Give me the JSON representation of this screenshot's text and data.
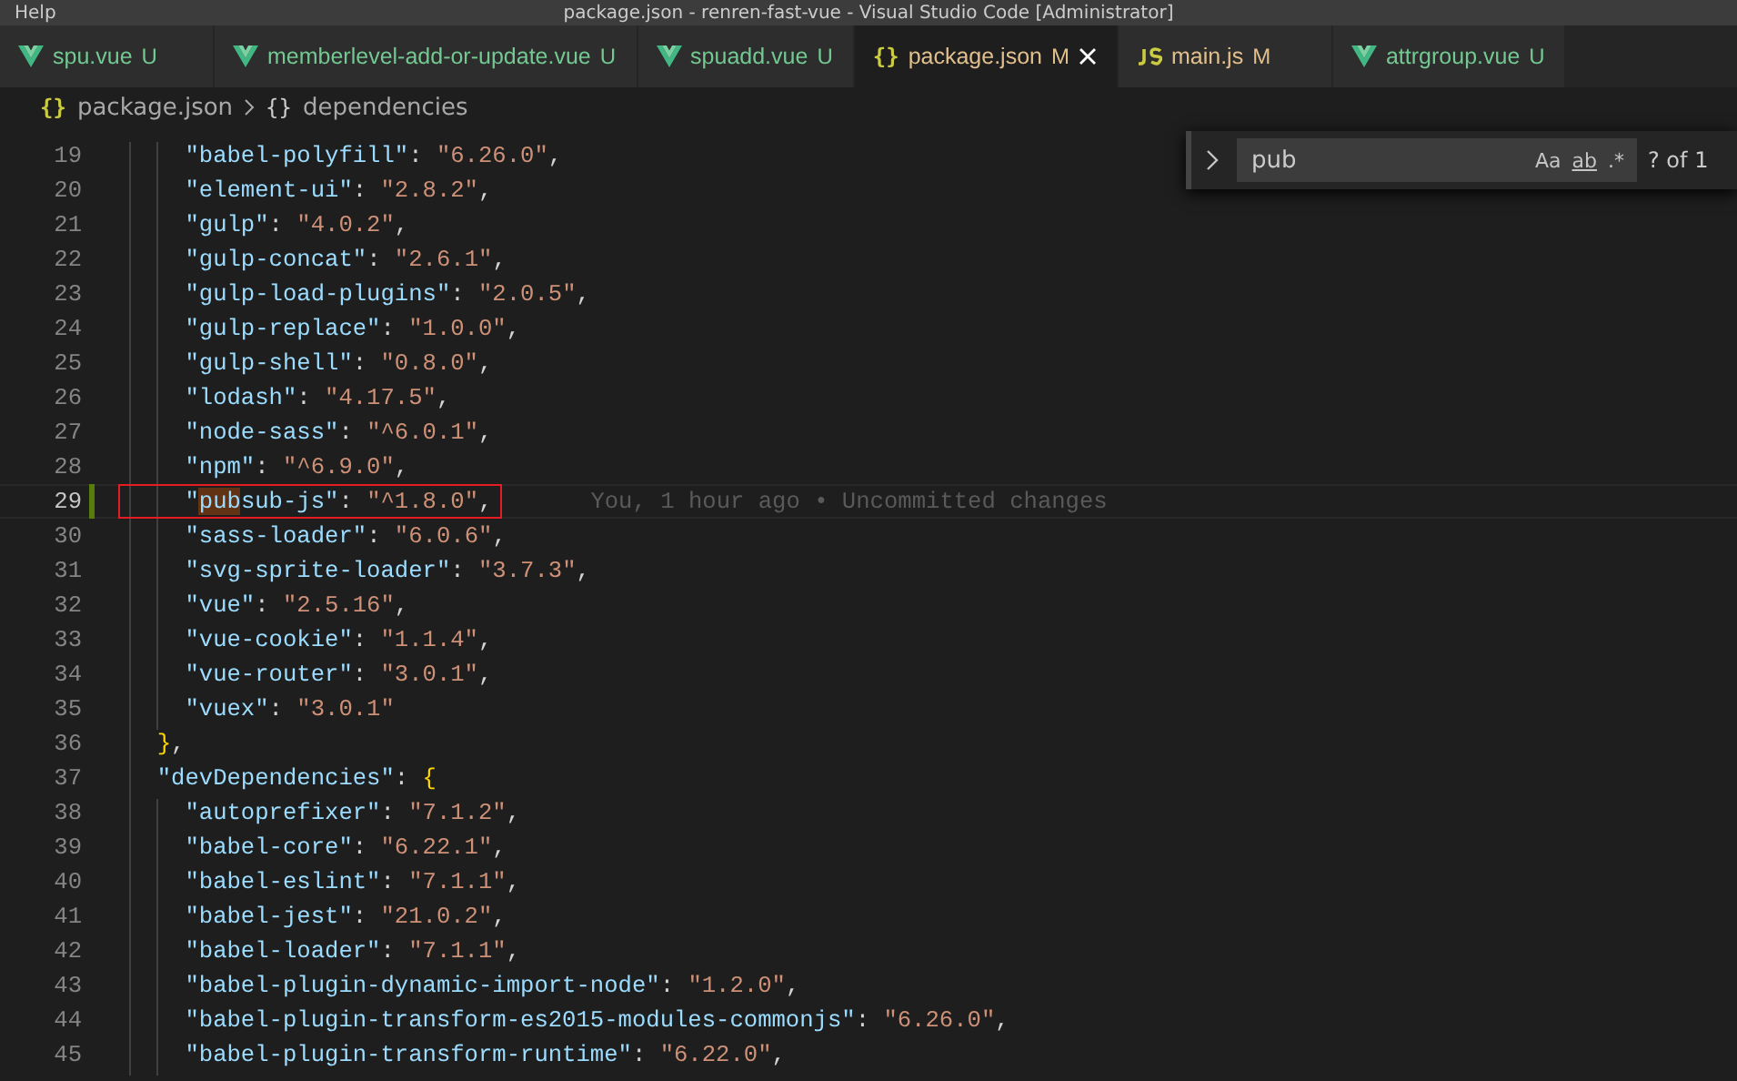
{
  "title_bar": {
    "menu": "Help",
    "title": "package.json - renren-fast-vue - Visual Studio Code [Administrator]"
  },
  "tabs": [
    {
      "kind": "vue",
      "label": "spu.vue",
      "status": "U",
      "selected": false
    },
    {
      "kind": "vue",
      "label": "memberlevel-add-or-update.vue",
      "status": "U",
      "selected": false
    },
    {
      "kind": "vue",
      "label": "spuadd.vue",
      "status": "U",
      "selected": false
    },
    {
      "kind": "json",
      "label": "package.json",
      "status": "M",
      "selected": true
    },
    {
      "kind": "js",
      "label": "main.js",
      "status": "M",
      "selected": false
    },
    {
      "kind": "vue",
      "label": "attrgroup.vue",
      "status": "U",
      "selected": false
    }
  ],
  "breadcrumb": [
    {
      "icon": "{}",
      "label": "package.json"
    },
    {
      "icon": "{}",
      "label": "dependencies"
    }
  ],
  "find_widget": {
    "value": "pub",
    "options": [
      "Aa",
      "ab",
      ".*"
    ],
    "count": "? of 1"
  },
  "lines": [
    {
      "number": "19",
      "tokens": [
        {
          "kind": "key",
          "text": "    \"babel-polyfill\""
        },
        {
          "kind": "punct",
          "text": ": "
        },
        {
          "kind": "string",
          "text": "\"6.26.0\""
        },
        {
          "kind": "punct",
          "text": ","
        }
      ]
    },
    {
      "number": "20",
      "tokens": [
        {
          "kind": "key",
          "text": "    \"element-ui\""
        },
        {
          "kind": "punct",
          "text": ": "
        },
        {
          "kind": "string",
          "text": "\"2.8.2\""
        },
        {
          "kind": "punct",
          "text": ","
        }
      ]
    },
    {
      "number": "21",
      "tokens": [
        {
          "kind": "key",
          "text": "    \"gulp\""
        },
        {
          "kind": "punct",
          "text": ": "
        },
        {
          "kind": "string",
          "text": "\"4.0.2\""
        },
        {
          "kind": "punct",
          "text": ","
        }
      ]
    },
    {
      "number": "22",
      "tokens": [
        {
          "kind": "key",
          "text": "    \"gulp-concat\""
        },
        {
          "kind": "punct",
          "text": ": "
        },
        {
          "kind": "string",
          "text": "\"2.6.1\""
        },
        {
          "kind": "punct",
          "text": ","
        }
      ]
    },
    {
      "number": "23",
      "tokens": [
        {
          "kind": "key",
          "text": "    \"gulp-load-plugins\""
        },
        {
          "kind": "punct",
          "text": ": "
        },
        {
          "kind": "string",
          "text": "\"2.0.5\""
        },
        {
          "kind": "punct",
          "text": ","
        }
      ]
    },
    {
      "number": "24",
      "tokens": [
        {
          "kind": "key",
          "text": "    \"gulp-replace\""
        },
        {
          "kind": "punct",
          "text": ": "
        },
        {
          "kind": "string",
          "text": "\"1.0.0\""
        },
        {
          "kind": "punct",
          "text": ","
        }
      ]
    },
    {
      "number": "25",
      "tokens": [
        {
          "kind": "key",
          "text": "    \"gulp-shell\""
        },
        {
          "kind": "punct",
          "text": ": "
        },
        {
          "kind": "string",
          "text": "\"0.8.0\""
        },
        {
          "kind": "punct",
          "text": ","
        }
      ]
    },
    {
      "number": "26",
      "tokens": [
        {
          "kind": "key",
          "text": "    \"lodash\""
        },
        {
          "kind": "punct",
          "text": ": "
        },
        {
          "kind": "string",
          "text": "\"4.17.5\""
        },
        {
          "kind": "punct",
          "text": ","
        }
      ]
    },
    {
      "number": "27",
      "tokens": [
        {
          "kind": "key",
          "text": "    \"node-sass\""
        },
        {
          "kind": "punct",
          "text": ": "
        },
        {
          "kind": "string",
          "text": "\"^6.0.1\""
        },
        {
          "kind": "punct",
          "text": ","
        }
      ]
    },
    {
      "number": "28",
      "tokens": [
        {
          "kind": "key",
          "text": "    \"npm\""
        },
        {
          "kind": "punct",
          "text": ": "
        },
        {
          "kind": "string",
          "text": "\"^6.9.0\""
        },
        {
          "kind": "punct",
          "text": ","
        }
      ]
    },
    {
      "number": "29",
      "current": true,
      "modified": true,
      "boxed": true,
      "blame": "You, 1 hour ago • Uncommitted changes",
      "tokens": [
        {
          "kind": "key",
          "text": "    \""
        },
        {
          "kind": "key",
          "text": "pub",
          "match": true
        },
        {
          "kind": "key",
          "text": "sub-js\""
        },
        {
          "kind": "punct",
          "text": ": "
        },
        {
          "kind": "string",
          "text": "\"^1.8.0\""
        },
        {
          "kind": "punct",
          "text": ","
        }
      ]
    },
    {
      "number": "30",
      "tokens": [
        {
          "kind": "key",
          "text": "    \"sass-loader\""
        },
        {
          "kind": "punct",
          "text": ": "
        },
        {
          "kind": "string",
          "text": "\"6.0.6\""
        },
        {
          "kind": "punct",
          "text": ","
        }
      ]
    },
    {
      "number": "31",
      "tokens": [
        {
          "kind": "key",
          "text": "    \"svg-sprite-loader\""
        },
        {
          "kind": "punct",
          "text": ": "
        },
        {
          "kind": "string",
          "text": "\"3.7.3\""
        },
        {
          "kind": "punct",
          "text": ","
        }
      ]
    },
    {
      "number": "32",
      "tokens": [
        {
          "kind": "key",
          "text": "    \"vue\""
        },
        {
          "kind": "punct",
          "text": ": "
        },
        {
          "kind": "string",
          "text": "\"2.5.16\""
        },
        {
          "kind": "punct",
          "text": ","
        }
      ]
    },
    {
      "number": "33",
      "tokens": [
        {
          "kind": "key",
          "text": "    \"vue-cookie\""
        },
        {
          "kind": "punct",
          "text": ": "
        },
        {
          "kind": "string",
          "text": "\"1.1.4\""
        },
        {
          "kind": "punct",
          "text": ","
        }
      ]
    },
    {
      "number": "34",
      "tokens": [
        {
          "kind": "key",
          "text": "    \"vue-router\""
        },
        {
          "kind": "punct",
          "text": ": "
        },
        {
          "kind": "string",
          "text": "\"3.0.1\""
        },
        {
          "kind": "punct",
          "text": ","
        }
      ]
    },
    {
      "number": "35",
      "tokens": [
        {
          "kind": "key",
          "text": "    \"vuex\""
        },
        {
          "kind": "punct",
          "text": ": "
        },
        {
          "kind": "string",
          "text": "\"3.0.1\""
        }
      ]
    },
    {
      "number": "36",
      "tokens": [
        {
          "kind": "brace",
          "text": "  }"
        },
        {
          "kind": "punct",
          "text": ","
        }
      ]
    },
    {
      "number": "37",
      "tokens": [
        {
          "kind": "key",
          "text": "  \"devDependencies\""
        },
        {
          "kind": "punct",
          "text": ": "
        },
        {
          "kind": "brace",
          "text": "{"
        }
      ]
    },
    {
      "number": "38",
      "tokens": [
        {
          "kind": "key",
          "text": "    \"autoprefixer\""
        },
        {
          "kind": "punct",
          "text": ": "
        },
        {
          "kind": "string",
          "text": "\"7.1.2\""
        },
        {
          "kind": "punct",
          "text": ","
        }
      ]
    },
    {
      "number": "39",
      "tokens": [
        {
          "kind": "key",
          "text": "    \"babel-core\""
        },
        {
          "kind": "punct",
          "text": ": "
        },
        {
          "kind": "string",
          "text": "\"6.22.1\""
        },
        {
          "kind": "punct",
          "text": ","
        }
      ]
    },
    {
      "number": "40",
      "tokens": [
        {
          "kind": "key",
          "text": "    \"babel-eslint\""
        },
        {
          "kind": "punct",
          "text": ": "
        },
        {
          "kind": "string",
          "text": "\"7.1.1\""
        },
        {
          "kind": "punct",
          "text": ","
        }
      ]
    },
    {
      "number": "41",
      "tokens": [
        {
          "kind": "key",
          "text": "    \"babel-jest\""
        },
        {
          "kind": "punct",
          "text": ": "
        },
        {
          "kind": "string",
          "text": "\"21.0.2\""
        },
        {
          "kind": "punct",
          "text": ","
        }
      ]
    },
    {
      "number": "42",
      "tokens": [
        {
          "kind": "key",
          "text": "    \"babel-loader\""
        },
        {
          "kind": "punct",
          "text": ": "
        },
        {
          "kind": "string",
          "text": "\"7.1.1\""
        },
        {
          "kind": "punct",
          "text": ","
        }
      ]
    },
    {
      "number": "43",
      "tokens": [
        {
          "kind": "key",
          "text": "    \"babel-plugin-dynamic-import-node\""
        },
        {
          "kind": "punct",
          "text": ": "
        },
        {
          "kind": "string",
          "text": "\"1.2.0\""
        },
        {
          "kind": "punct",
          "text": ","
        }
      ]
    },
    {
      "number": "44",
      "tokens": [
        {
          "kind": "key",
          "text": "    \"babel-plugin-transform-es2015-modules-commonjs\""
        },
        {
          "kind": "punct",
          "text": ": "
        },
        {
          "kind": "string",
          "text": "\"6.26.0\""
        },
        {
          "kind": "punct",
          "text": ","
        }
      ]
    },
    {
      "number": "45",
      "tokens": [
        {
          "kind": "key",
          "text": "    \"babel-plugin-transform-runtime\""
        },
        {
          "kind": "punct",
          "text": ": "
        },
        {
          "kind": "string",
          "text": "\"6.22.0\""
        },
        {
          "kind": "punct",
          "text": ","
        }
      ]
    }
  ]
}
